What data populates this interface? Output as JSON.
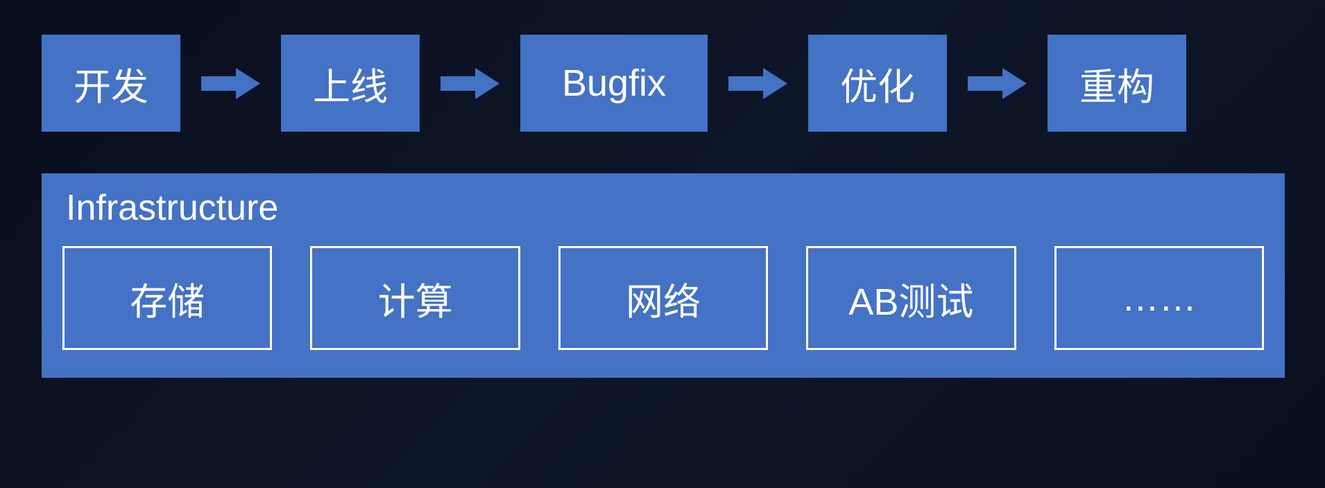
{
  "flow": {
    "steps": [
      {
        "label": "开发"
      },
      {
        "label": "上线"
      },
      {
        "label": "Bugfix"
      },
      {
        "label": "优化"
      },
      {
        "label": "重构"
      }
    ]
  },
  "infrastructure": {
    "title": "Infrastructure",
    "items": [
      {
        "label": "存储"
      },
      {
        "label": "计算"
      },
      {
        "label": "网络"
      },
      {
        "label": "AB测试"
      },
      {
        "label": "……"
      }
    ]
  }
}
